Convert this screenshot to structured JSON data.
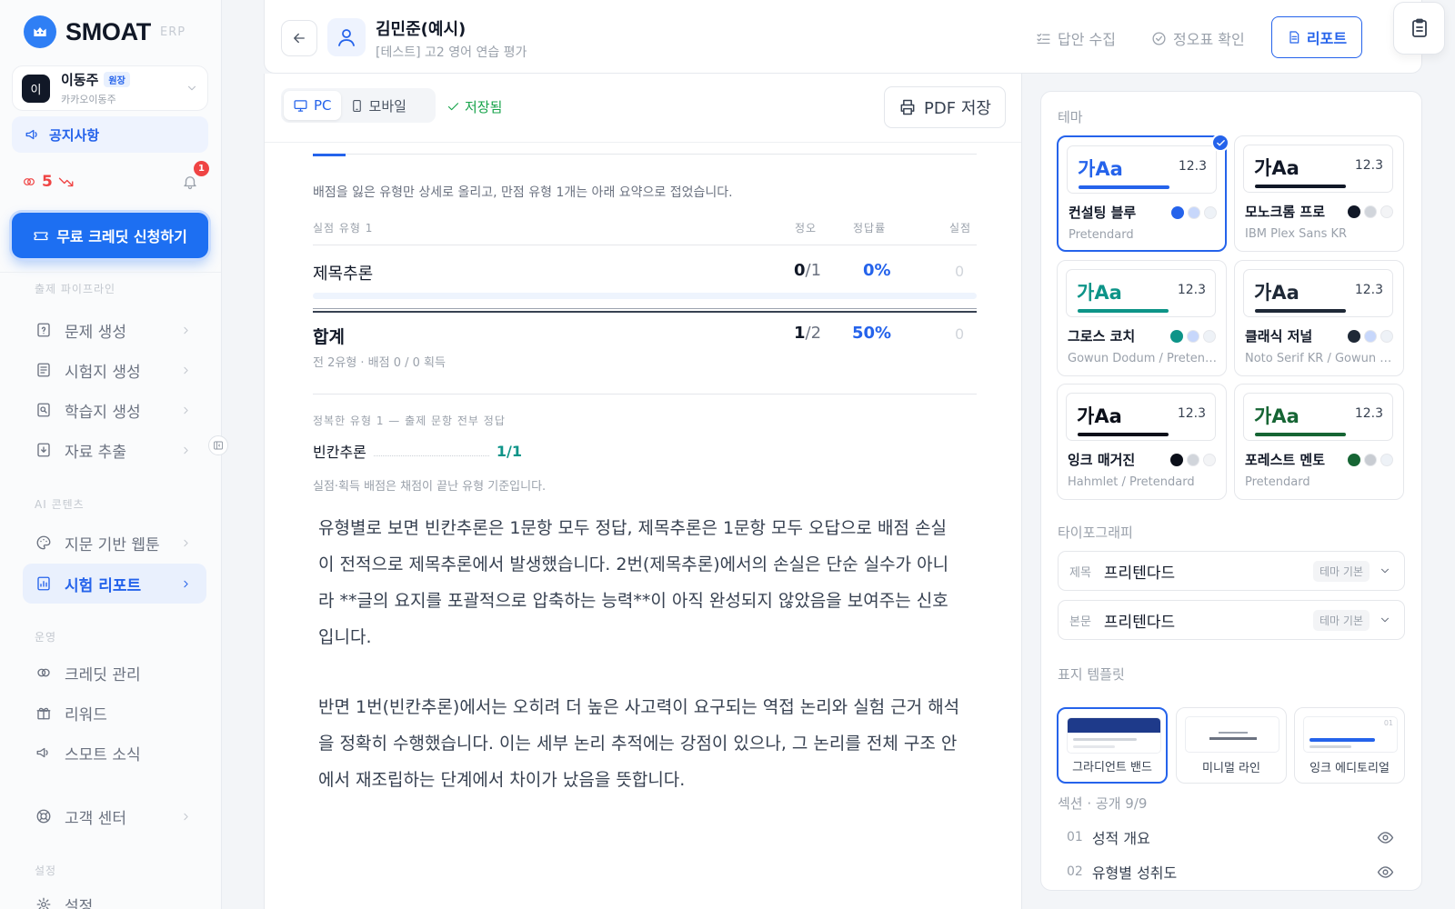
{
  "brand": {
    "name": "SMOAT",
    "tag": "ERP",
    "logo_icon": "smoat-logo-icon",
    "accent": "#2563eb"
  },
  "user": {
    "initial": "이",
    "name": "이동주",
    "role": "원장",
    "company": "카카오이동주"
  },
  "notice": {
    "label": "공지사항"
  },
  "credits": {
    "count": "5",
    "trend": "down",
    "notifications": "1"
  },
  "cta": {
    "label": "무료 크레딧 신청하기"
  },
  "nav": {
    "pipeline_label": "출제 파이프라인",
    "pipeline_items": [
      {
        "label": "문제 생성",
        "icon": "question-doc-icon"
      },
      {
        "label": "시험지 생성",
        "icon": "sheet-icon"
      },
      {
        "label": "학습지 생성",
        "icon": "worksheet-icon"
      },
      {
        "label": "자료 추출",
        "icon": "extract-icon"
      }
    ],
    "ai_label": "AI 콘텐츠",
    "ai_items": [
      {
        "label": "지문 기반 웹툰",
        "icon": "palette-icon"
      },
      {
        "label": "시험 리포트",
        "icon": "report-icon",
        "active": true
      }
    ],
    "ops_label": "운영",
    "ops_items": [
      {
        "label": "크레딧 관리",
        "icon": "credit-icon"
      },
      {
        "label": "리워드",
        "icon": "gift-icon"
      },
      {
        "label": "스모트 소식",
        "icon": "megaphone-icon"
      }
    ],
    "support": {
      "label": "고객 센터",
      "icon": "lifebuoy-icon"
    },
    "settings_label": "설정",
    "settings_item": {
      "label": "설정",
      "icon": "gear-icon"
    }
  },
  "header": {
    "student_name": "김민준(예시)",
    "exam_title": "[테스트] 고2 영어 연습 평가",
    "tabs": [
      {
        "label": "답안 수집",
        "icon": "list-check-icon"
      },
      {
        "label": "정오표 확인",
        "icon": "check-circle-icon"
      }
    ],
    "report_label": "리포트"
  },
  "toolbar": {
    "pc": "PC",
    "mobile": "모바일",
    "saved": "저장됨",
    "pdf": "PDF 저장"
  },
  "report": {
    "intro": "배점을 잃은 유형만 상세로 올리고, 만점 유형 1개는 아래 요약으로 접었습니다.",
    "col_type": "실점 유형 1",
    "col_correct": "정오",
    "col_rate": "정답률",
    "col_loss": "실점",
    "rows": [
      {
        "name": "제목추론",
        "correct": "0",
        "total": "/1",
        "rate": "0%",
        "loss": "0"
      }
    ],
    "total": {
      "label": "합계",
      "sub": "전 2유형 · 배점 0 / 0 획득",
      "correct": "1",
      "total": "/2",
      "rate": "50%",
      "loss": "0"
    },
    "perfect_header": "정복한 유형 1 — 출제 문항 전부 정답",
    "perfect_items": [
      {
        "name": "빈칸추론",
        "value": "1/1"
      }
    ],
    "note": "실점·획득 배점은 채점이 끝난 유형 기준입니다.",
    "para1": "유형별로 보면 빈칸추론은 1문항 모두 정답, 제목추론은 1문항 모두 오답으로 배점 손실이 전적으로 제목추론에서 발생했습니다. 2번(제목추론)에서의 손실은 단순 실수가 아니라 **글의 요지를 포괄적으로 압축하는 능력**이 아직 완성되지 않았음을 보여주는 신호입니다.",
    "para2": "반면 1번(빈칸추론)에서는 오히려 더 높은 사고력이 요구되는 역접 논리와 실험 근거 해석을 정확히 수행했습니다. 이는 세부 논리 추적에는 강점이 있으나, 그 논리를 전체 구조 안에서 재조립하는 단계에서 차이가 났음을 뜻합니다."
  },
  "settings": {
    "theme_label": "테마",
    "themes": [
      {
        "name": "컨설팅 블루",
        "font": "Pretendard",
        "sample": "가Aa",
        "size": "12.3",
        "color": "#2563eb",
        "swatches": [
          "#2563eb",
          "#c7d7fb",
          "#eef2f7"
        ],
        "selected": true
      },
      {
        "name": "모노크롬 프로",
        "font": "IBM Plex Sans KR",
        "sample": "가Aa",
        "size": "12.3",
        "color": "#111827",
        "swatches": [
          "#111827",
          "#d1d5db",
          "#f3f4f6"
        ]
      },
      {
        "name": "그로스 코치",
        "font": "Gowun Dodum / Pretendard",
        "sample": "가Aa",
        "size": "12.3",
        "color": "#0d9488",
        "swatches": [
          "#0d9488",
          "#c7d7fb",
          "#eef2f7"
        ]
      },
      {
        "name": "클래식 저널",
        "font": "Noto Serif KR / Gowun Batang",
        "sample": "가Aa",
        "size": "12.3",
        "color": "#1f2937",
        "swatches": [
          "#1f2937",
          "#c7d7fb",
          "#eef2f7"
        ]
      },
      {
        "name": "잉크 매거진",
        "font": "Hahmlet / Pretendard",
        "sample": "가Aa",
        "size": "12.3",
        "color": "#0b0f19",
        "swatches": [
          "#0b0f19",
          "#d1d5db",
          "#f3f4f6"
        ]
      },
      {
        "name": "포레스트 멘토",
        "font": "Pretendard",
        "sample": "가Aa",
        "size": "12.3",
        "color": "#166534",
        "swatches": [
          "#166534",
          "#c8ccd2",
          "#eef2f7"
        ]
      }
    ],
    "typo_label": "타이포그래피",
    "typo": [
      {
        "key": "제목",
        "value": "프리텐다드",
        "badge": "테마 기본"
      },
      {
        "key": "본문",
        "value": "프리텐다드",
        "badge": "테마 기본"
      }
    ],
    "cover_label": "표지 템플릿",
    "covers": [
      {
        "label": "그라디언트 밴드",
        "selected": true
      },
      {
        "label": "미니멀 라인"
      },
      {
        "label": "잉크 에디토리얼",
        "mark": "01"
      }
    ],
    "sections_label": "섹션 · 공개 9/9",
    "sections": [
      {
        "no": "01",
        "label": "성적 개요"
      },
      {
        "no": "02",
        "label": "유형별 성취도"
      }
    ]
  }
}
